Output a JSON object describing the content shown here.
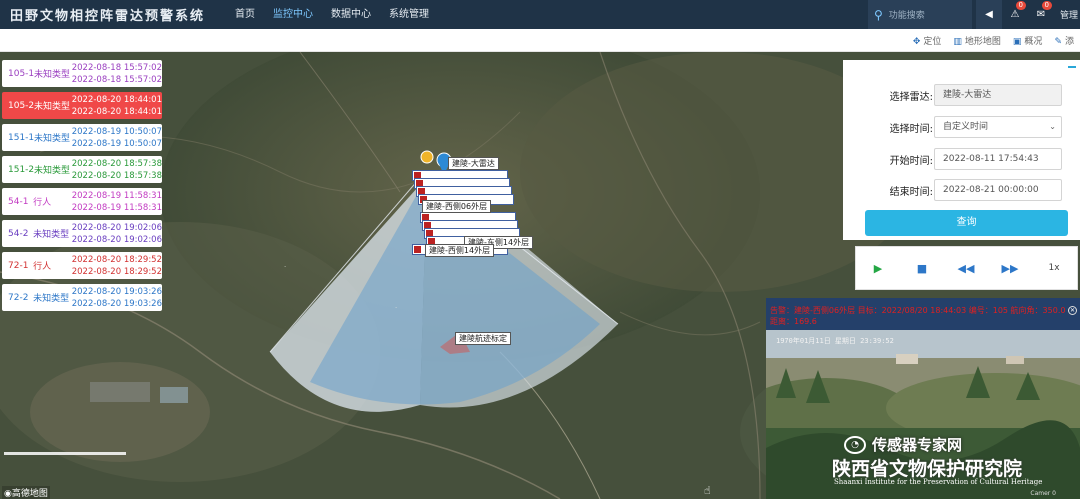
{
  "header": {
    "brand": "田野文物相控阵雷达预警系统",
    "nav": [
      "首页",
      "监控中心",
      "数据中心",
      "系统管理"
    ],
    "active_nav": 1,
    "search_placeholder": "功能搜索",
    "alarm_count": "0",
    "message_count": "0",
    "admin_label": "管理"
  },
  "toolbar": {
    "locate": "定位",
    "terrain": "地形地图",
    "overview": "概况",
    "edit": "添"
  },
  "tracks": [
    {
      "id": "105-1",
      "type": "未知类型",
      "t1": "2022-08-18 15:57:02",
      "t2": "2022-08-18 15:57:02",
      "color": "#9a3fc0",
      "bg": "#ffffff",
      "tcolor": "#9a3fc0"
    },
    {
      "id": "105-2",
      "type": "未知类型",
      "t1": "2022-08-20 18:44:01",
      "t2": "2022-08-20 18:44:01",
      "color": "#ffffff",
      "bg": "#f04848",
      "tcolor": "#ffffff"
    },
    {
      "id": "151-1",
      "type": "未知类型",
      "t1": "2022-08-19 10:50:07",
      "t2": "2022-08-19 10:50:07",
      "color": "#2d77c8",
      "bg": "#ffffff",
      "tcolor": "#2d77c8"
    },
    {
      "id": "151-2",
      "type": "未知类型",
      "t1": "2022-08-20 18:57:38",
      "t2": "2022-08-20 18:57:38",
      "color": "#2a9a3a",
      "bg": "#ffffff",
      "tcolor": "#2a9a3a"
    },
    {
      "id": "54-1",
      "type": "行人",
      "t1": "2022-08-19 11:58:31",
      "t2": "2022-08-19 11:58:31",
      "color": "#c23bc2",
      "bg": "#ffffff",
      "tcolor": "#c23bc2"
    },
    {
      "id": "54-2",
      "type": "未知类型",
      "t1": "2022-08-20 19:02:06",
      "t2": "2022-08-20 19:02:06",
      "color": "#6a3fc0",
      "bg": "#ffffff",
      "tcolor": "#6a3fc0"
    },
    {
      "id": "72-1",
      "type": "行人",
      "t1": "2022-08-20 18:29:52",
      "t2": "2022-08-20 18:29:52",
      "color": "#d23232",
      "bg": "#ffffff",
      "tcolor": "#d23232"
    },
    {
      "id": "72-2",
      "type": "未知类型",
      "t1": "2022-08-20 19:03:26",
      "t2": "2022-08-20 19:03:26",
      "color": "#2d77c8",
      "bg": "#ffffff",
      "tcolor": "#2d77c8"
    }
  ],
  "map": {
    "radar_label": "建陵-大雷达",
    "zone_label_1": "建陵-西侧06外层",
    "zone_label_2": "建陵-东侧14外层",
    "zone_label_3": "建陵-西侧14外层",
    "calib_label": "建陵航迹标定",
    "provider": "高德地图"
  },
  "query": {
    "radar_label": "选择雷达:",
    "radar_value": "建陵-大雷达",
    "time_label": "选择时间:",
    "time_value": "自定义时间",
    "start_label": "开始时间:",
    "start_value": "2022-08-11 17:54:43",
    "end_label": "结束时间:",
    "end_value": "2022-08-21 00:00:00",
    "submit": "查询"
  },
  "player": {
    "speed": "1x"
  },
  "video": {
    "alert": "告警：建陵-西侧06外层 目标：2022/08/20 18:44:03 编号：105 航向角：350.0 距离：169.6",
    "timestamp": "1970年01月11日  星期日  23:39:52",
    "watermark": "传感器专家网",
    "org_cn": "陕西省文物保护研究院",
    "org_en": "Shaanxi Institute for the Preservation of Cultural Heritage",
    "camera": "Camer 0"
  }
}
